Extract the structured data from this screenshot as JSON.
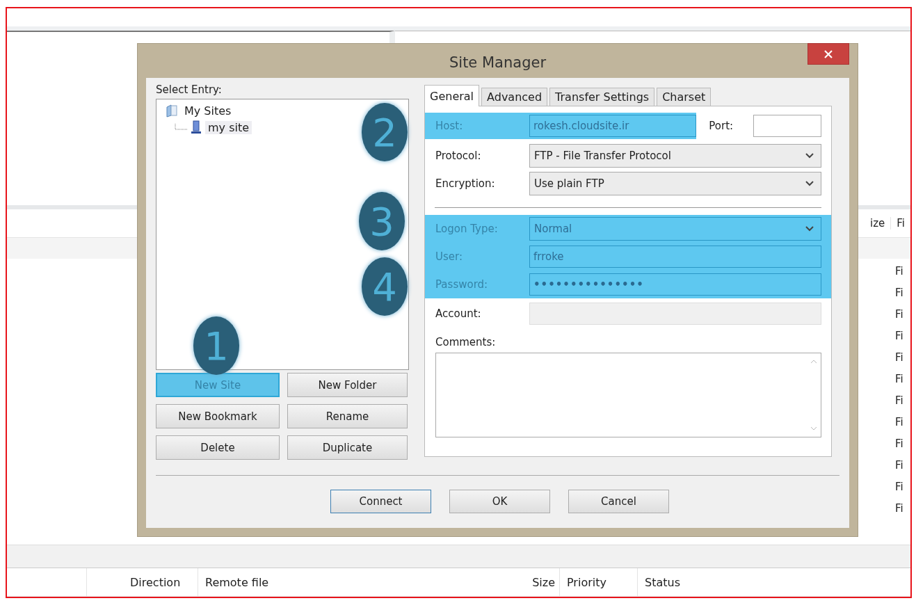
{
  "background": {
    "remote_columns": [
      "ize",
      "Fi"
    ],
    "remote_rows": [
      "Fi",
      "Fi",
      "Fi",
      "Fi",
      "Fi",
      "Fi",
      "Fi",
      "Fi",
      "Fi",
      "Fi",
      "Fi",
      "Fi"
    ],
    "queue_columns": [
      "Direction",
      "Remote file",
      "Size",
      "Priority",
      "Status"
    ]
  },
  "dialog": {
    "title": "Site Manager",
    "select_entry_label": "Select Entry:",
    "tree": [
      {
        "label": "My Sites",
        "kind": "folder",
        "selected": false,
        "children": [
          {
            "label": "my site",
            "kind": "site",
            "selected": true
          }
        ]
      }
    ],
    "site_buttons": [
      {
        "label": "New Site",
        "highlighted": true
      },
      {
        "label": "New Folder",
        "highlighted": false
      },
      {
        "label": "New Bookmark",
        "highlighted": false
      },
      {
        "label": "Rename",
        "highlighted": false
      },
      {
        "label": "Delete",
        "highlighted": false
      },
      {
        "label": "Duplicate",
        "highlighted": false
      }
    ],
    "tabs": [
      {
        "label": "General",
        "selected": true
      },
      {
        "label": "Advanced",
        "selected": false
      },
      {
        "label": "Transfer Settings",
        "selected": false
      },
      {
        "label": "Charset",
        "selected": false
      }
    ],
    "fields": [
      {
        "kind": "host",
        "label": "Host:",
        "value": "rokesh.cloudsite.ir",
        "port_label": "Port:",
        "highlighted": true
      },
      {
        "kind": "select",
        "label": "Protocol:",
        "value": "FTP - File Transfer Protocol",
        "highlighted": false
      },
      {
        "kind": "select",
        "label": "Encryption:",
        "value": "Use plain FTP",
        "highlighted": false
      },
      {
        "kind": "separator"
      },
      {
        "kind": "select",
        "label": "Logon Type:",
        "value": "Normal",
        "highlighted": true
      },
      {
        "kind": "text",
        "label": "User:",
        "value": "frroke",
        "highlighted": true
      },
      {
        "kind": "text",
        "label": "Password:",
        "value": "•••••••••••••••",
        "highlighted": true
      },
      {
        "kind": "text",
        "label": "Account:",
        "highlighted": false,
        "disabled": true
      },
      {
        "kind": "textarea",
        "label": "Comments:"
      }
    ],
    "footer_buttons": [
      {
        "label": "Connect",
        "focused": true
      },
      {
        "label": "OK",
        "focused": false
      },
      {
        "label": "Cancel",
        "focused": false
      }
    ]
  },
  "callouts": [
    "1",
    "2",
    "3",
    "4"
  ]
}
